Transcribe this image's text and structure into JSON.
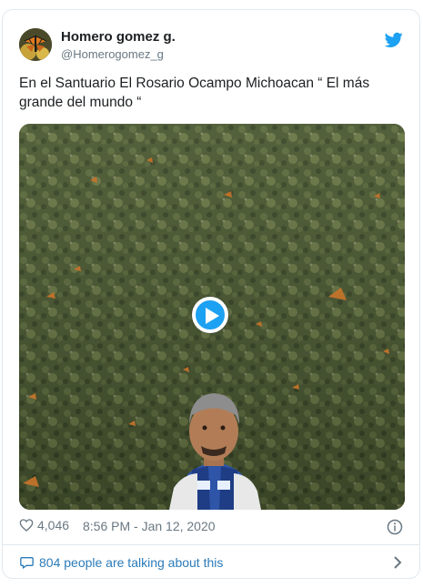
{
  "tweet": {
    "display_name": "Homero gomez g.",
    "handle": "@Homerogomez_g",
    "text": "En el Santuario El Rosario Ocampo Michoacan “ El más grande del mundo “",
    "likes": "4,046",
    "timestamp": "8:56 PM - Jan 12, 2020",
    "talking": "804 people are talking about this"
  },
  "colors": {
    "accent": "#1da1f2",
    "link": "#2b7bb9",
    "muted": "#697882",
    "border": "#e1e8ed"
  },
  "icons": {
    "brand": "twitter-bird-icon",
    "play": "play-icon",
    "like": "heart-icon",
    "info": "info-icon",
    "reply": "speech-bubble-icon",
    "more": "chevron-right-icon"
  }
}
